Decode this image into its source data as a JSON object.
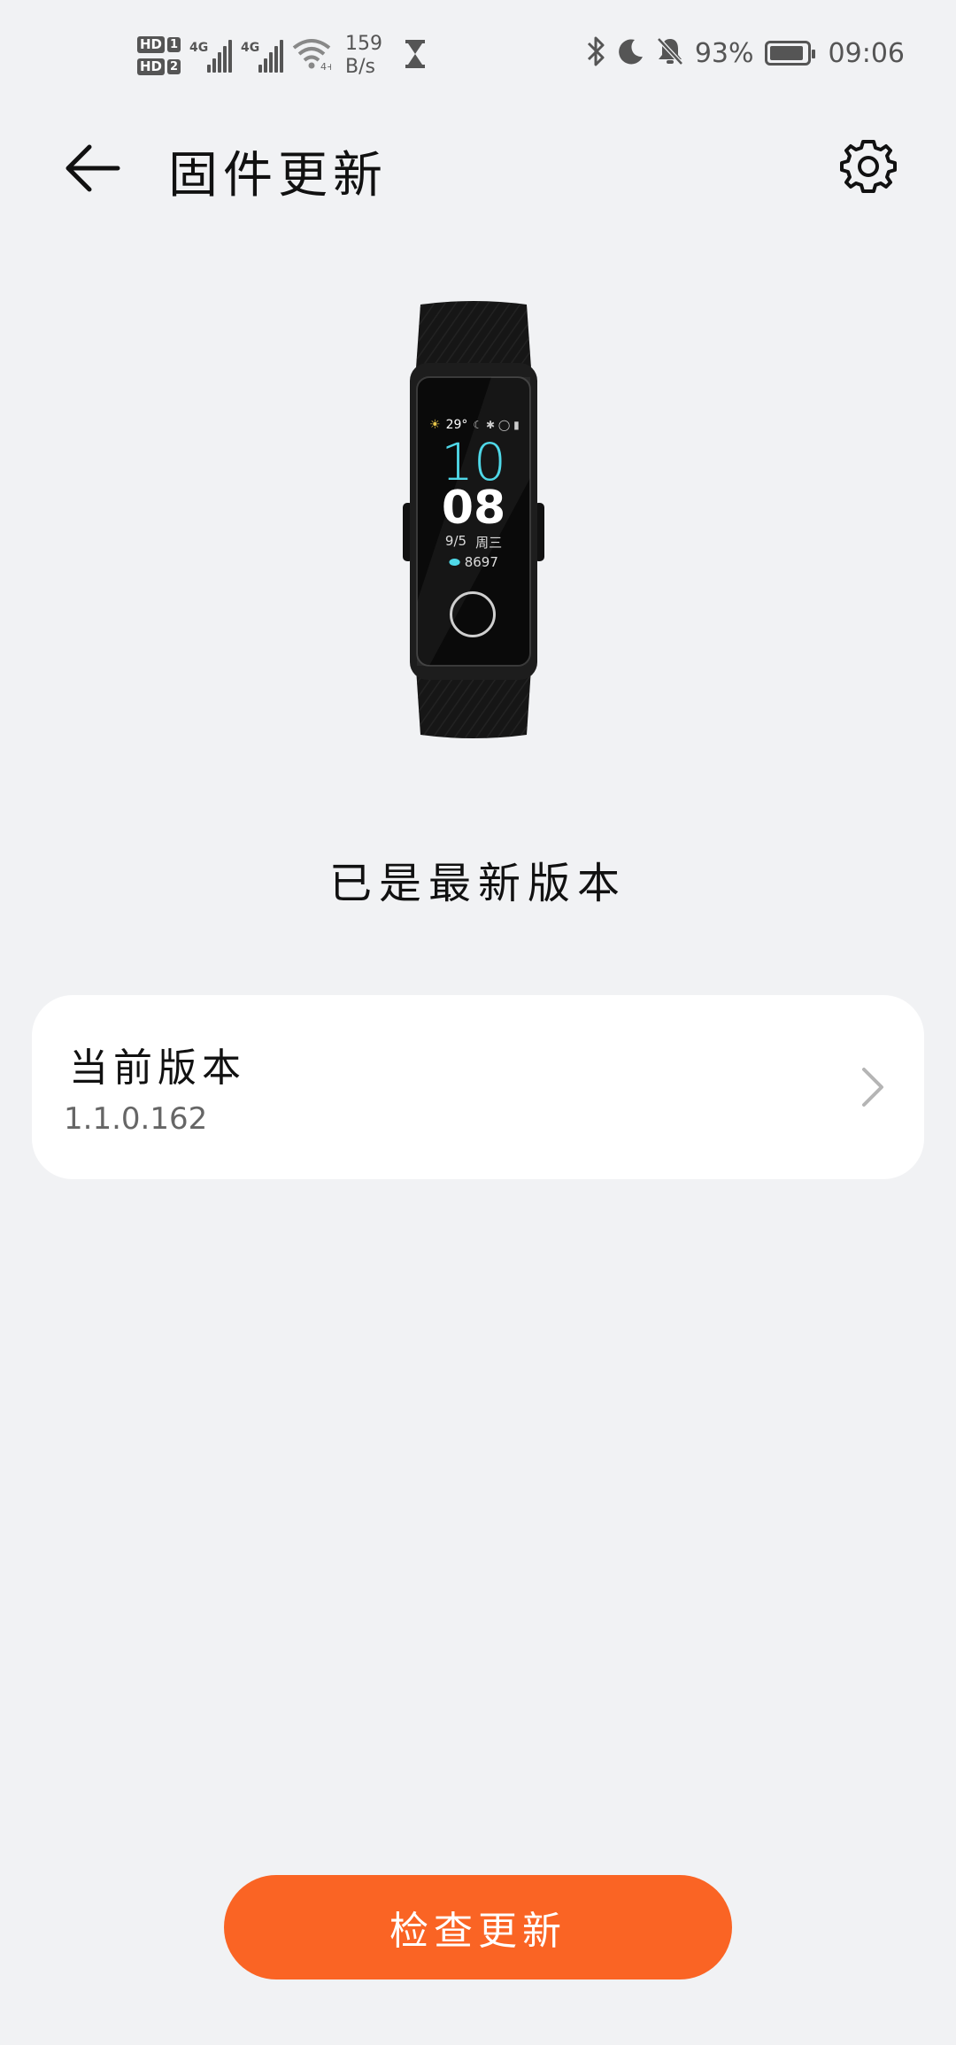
{
  "status_bar": {
    "hd1": "HD",
    "hd1_num": "1",
    "hd2": "HD",
    "hd2_num": "2",
    "sim1_tag": "4G",
    "sim2_tag": "4G",
    "speed_value": "159",
    "speed_unit": "B/s",
    "battery_text": "93%",
    "battery_level": 0.93,
    "time": "09:06",
    "icons": [
      "hd-icon",
      "signal-icon",
      "wifi-icon",
      "hourglass-icon",
      "bluetooth-icon",
      "moon-icon",
      "bell-off-icon",
      "battery-icon"
    ]
  },
  "app_bar": {
    "title": "固件更新",
    "back_icon": "arrow-left-icon",
    "settings_icon": "gear-icon"
  },
  "device": {
    "screen_temp": "29°",
    "screen_hour": "10",
    "screen_minute": "08",
    "screen_date": "9/5",
    "screen_weekday": "周三",
    "screen_steps": "8697"
  },
  "status": {
    "message": "已是最新版本"
  },
  "version_card": {
    "label": "当前版本",
    "value": "1.1.0.162",
    "chevron_icon": "chevron-right-icon"
  },
  "actions": {
    "check_update_label": "检查更新"
  },
  "colors": {
    "accent": "#fa6424",
    "background": "#f1f2f4",
    "card": "#ffffff"
  }
}
